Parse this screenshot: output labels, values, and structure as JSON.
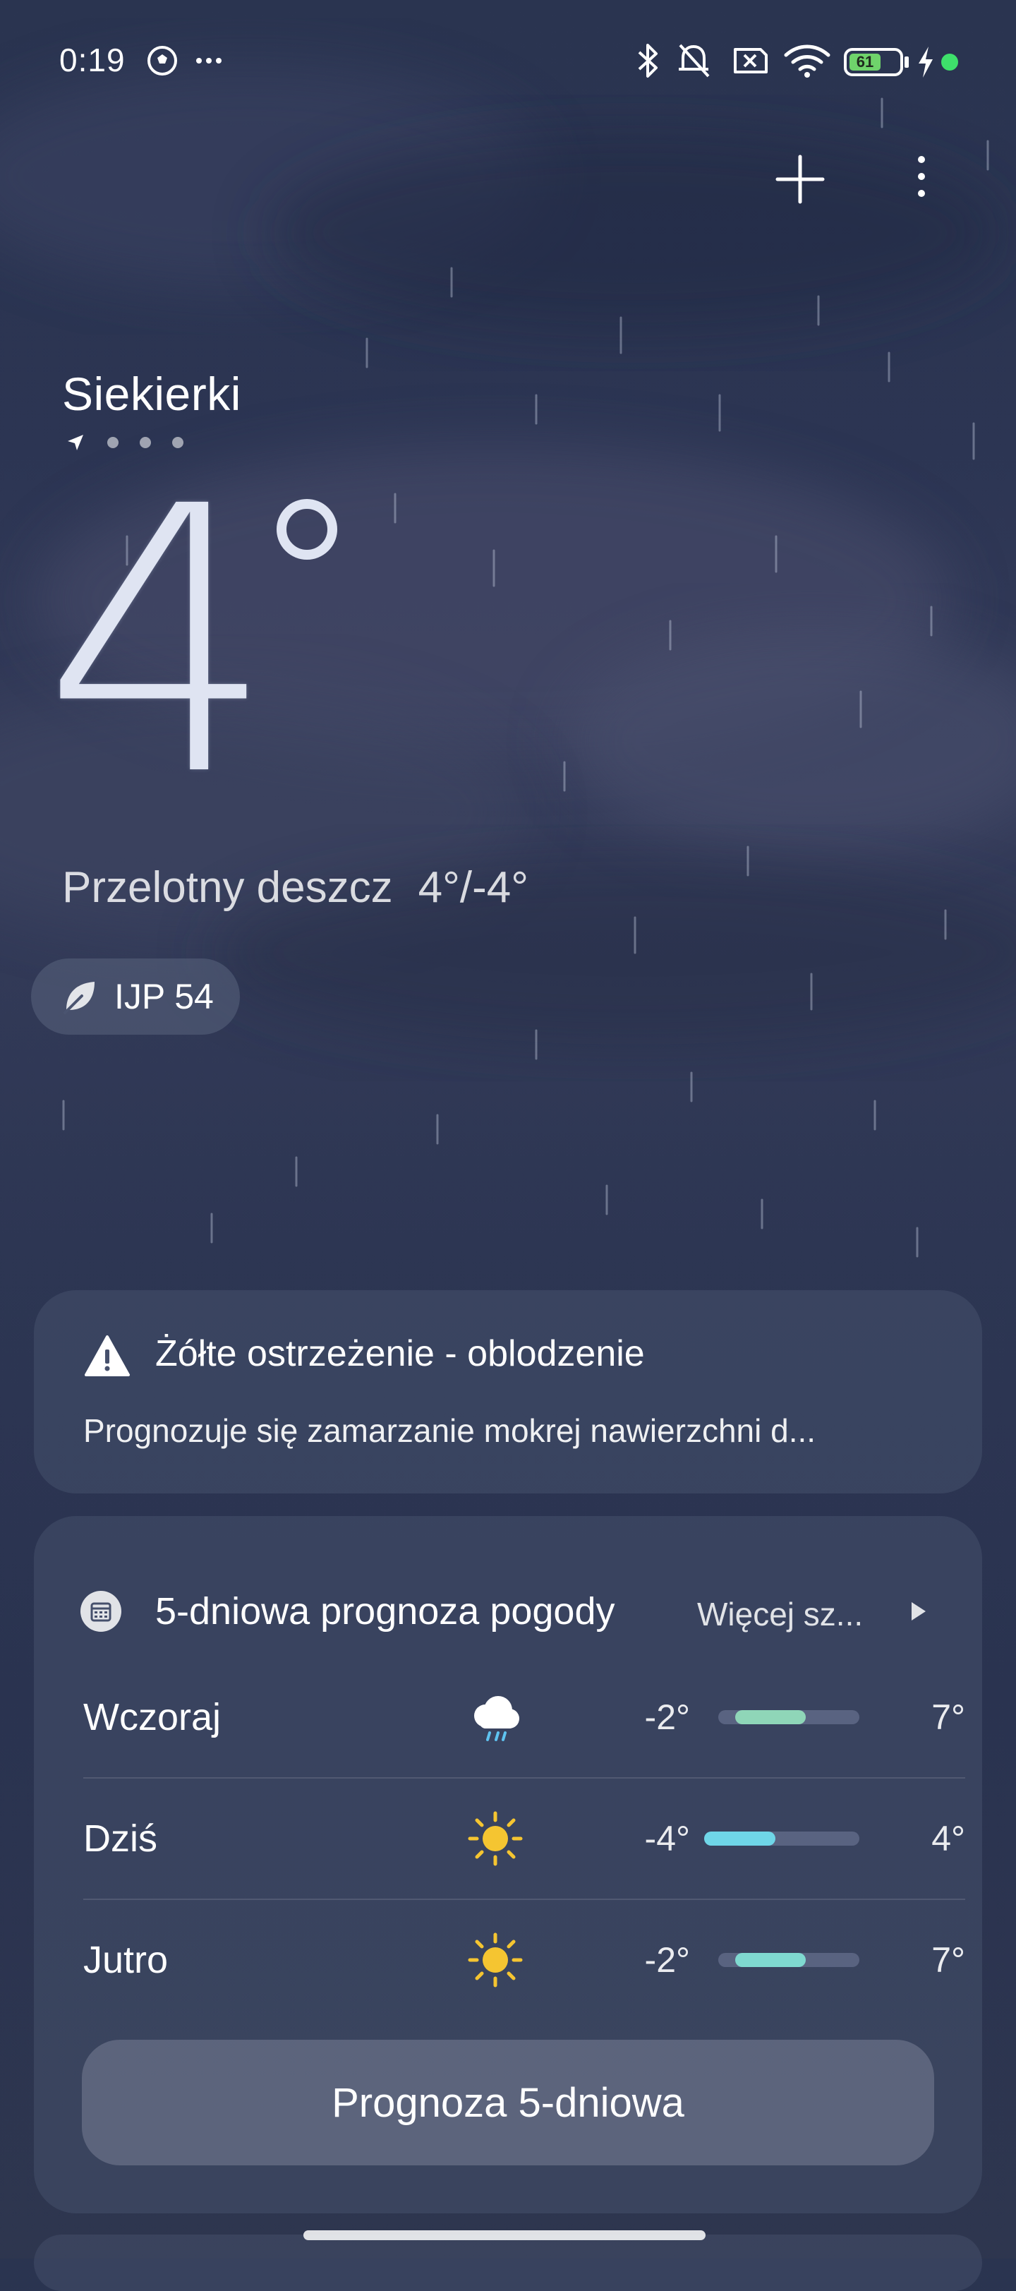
{
  "status_bar": {
    "time": "0:19",
    "battery_level": "61",
    "icons": [
      "soccer-ball-icon",
      "more-dots-icon",
      "bluetooth-icon",
      "mute-icon",
      "no-sim-icon",
      "wifi-icon",
      "battery-icon",
      "charging-icon"
    ]
  },
  "header": {
    "add_icon": "plus-icon",
    "menu_icon": "more-vertical-icon"
  },
  "location": {
    "name": "Siekierki",
    "pages": 4,
    "active_page": 0
  },
  "current": {
    "temperature": "4",
    "condition": "Przelotny deszcz",
    "range": "4°/-4°",
    "aqi_label": "IJP 54"
  },
  "warning": {
    "title": "Żółte ostrzeżenie - oblodzenie",
    "description": "Prognozuje się zamarzanie mokrej nawierzchni d..."
  },
  "forecast": {
    "title": "5-dniowa prognoza pogody",
    "more_label": "Więcej sz...",
    "days": [
      {
        "name": "Wczoraj",
        "icon": "rain-cloud-icon",
        "low": "-2°",
        "high": "7°",
        "bar_start": 0.12,
        "bar_end": 0.62,
        "bar_color": "#8fd6b8"
      },
      {
        "name": "Dziś",
        "icon": "sun-icon",
        "low": "-4°",
        "high": "4°",
        "bar_start": 0.0,
        "bar_end": 0.46,
        "bar_color": "#6fd6e8"
      },
      {
        "name": "Jutro",
        "icon": "sun-icon",
        "low": "-2°",
        "high": "7°",
        "bar_start": 0.12,
        "bar_end": 0.62,
        "bar_color": "#7fd9d0"
      }
    ],
    "button_label": "Prognoza 5-dniowa"
  },
  "colors": {
    "background_top": "#2a3450",
    "card": "#46506c",
    "sun": "#f5c531",
    "battery_green": "#6fd36b"
  }
}
